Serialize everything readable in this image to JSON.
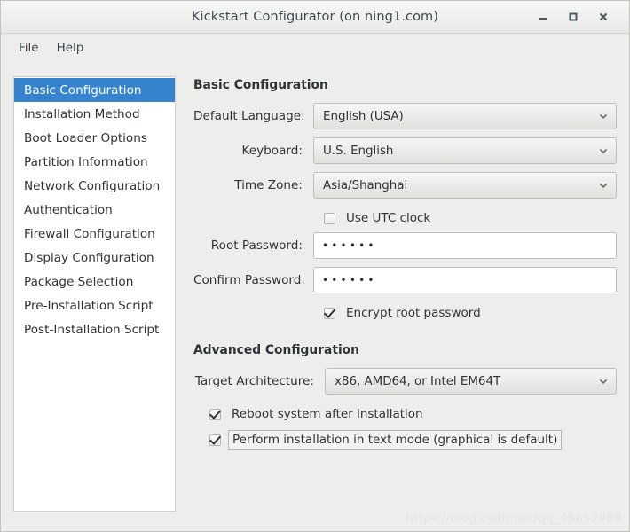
{
  "window": {
    "title": "Kickstart Configurator (on ning1.com)",
    "controls": [
      {
        "name": "minimize",
        "label": "_"
      },
      {
        "name": "maximize",
        "label": "□"
      },
      {
        "name": "close",
        "label": "×"
      }
    ]
  },
  "menubar": {
    "items": [
      {
        "label": "File"
      },
      {
        "label": "Help"
      }
    ]
  },
  "sidebar": {
    "items": [
      {
        "label": "Basic Configuration",
        "selected": true
      },
      {
        "label": "Installation Method",
        "selected": false
      },
      {
        "label": "Boot Loader Options",
        "selected": false
      },
      {
        "label": "Partition Information",
        "selected": false
      },
      {
        "label": "Network Configuration",
        "selected": false
      },
      {
        "label": "Authentication",
        "selected": false
      },
      {
        "label": "Firewall Configuration",
        "selected": false
      },
      {
        "label": "Display Configuration",
        "selected": false
      },
      {
        "label": "Package Selection",
        "selected": false
      },
      {
        "label": "Pre-Installation Script",
        "selected": false
      },
      {
        "label": "Post-Installation Script",
        "selected": false
      }
    ]
  },
  "main": {
    "basic": {
      "title": "Basic Configuration",
      "language": {
        "label": "Default Language:",
        "value": "English (USA)"
      },
      "keyboard": {
        "label": "Keyboard:",
        "value": "U.S. English"
      },
      "timezone": {
        "label": "Time Zone:",
        "value": "Asia/Shanghai"
      },
      "utc": {
        "label": "Use UTC clock",
        "checked": false
      },
      "root_password": {
        "label": "Root Password:",
        "value": "••••••"
      },
      "confirm_password": {
        "label": "Confirm Password:",
        "value": "••••••"
      },
      "encrypt": {
        "label": "Encrypt root password",
        "checked": true
      }
    },
    "advanced": {
      "title": "Advanced Configuration",
      "architecture": {
        "label": "Target Architecture:",
        "value": "x86, AMD64, or Intel EM64T"
      },
      "reboot": {
        "label": "Reboot system after installation",
        "checked": true
      },
      "textmode": {
        "label": "Perform installation in text mode (graphical is default)",
        "checked": true
      }
    }
  },
  "watermark": "https://blog.csdn.net/qq_45652989",
  "colors": {
    "accent": "#3584cd",
    "window_bg": "#ededec",
    "list_bg": "#ffffff",
    "text": "#2e3436"
  }
}
